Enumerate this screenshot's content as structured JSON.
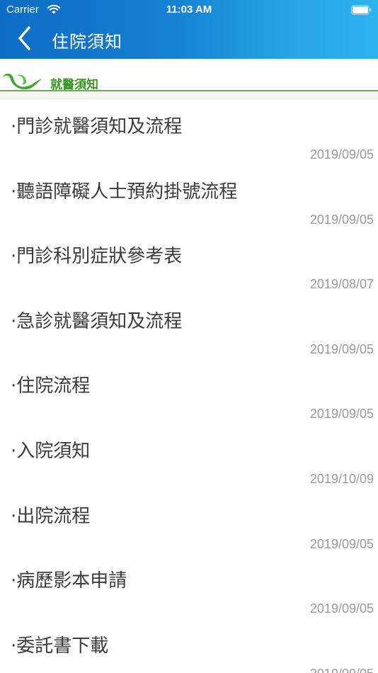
{
  "status_bar": {
    "carrier": "Carrier",
    "time": "11:03 AM"
  },
  "nav": {
    "title": "住院須知",
    "back_icon": "chevron-left-icon"
  },
  "section": {
    "title": "就醫須知",
    "logo_icon": "green-wave-logo-icon",
    "accent_color": "#35981f"
  },
  "colors": {
    "header_start": "#0c6cc4",
    "header_end": "#2eb2ee",
    "title_text": "#3b3b3b",
    "date_text": "#9a9a9a"
  },
  "items": [
    {
      "title": "·門診就醫須知及流程",
      "date": "2019/09/05"
    },
    {
      "title": "·聽語障礙人士預約掛號流程",
      "date": "2019/09/05"
    },
    {
      "title": "·門診科別症狀參考表",
      "date": "2019/08/07"
    },
    {
      "title": "·急診就醫須知及流程",
      "date": "2019/09/05"
    },
    {
      "title": "·住院流程",
      "date": "2019/09/05"
    },
    {
      "title": "·入院須知",
      "date": "2019/10/09"
    },
    {
      "title": "·出院流程",
      "date": "2019/09/05"
    },
    {
      "title": "·病歷影本申請",
      "date": "2019/09/05"
    },
    {
      "title": "·委託書下載",
      "date": "2019/09/05"
    }
  ]
}
